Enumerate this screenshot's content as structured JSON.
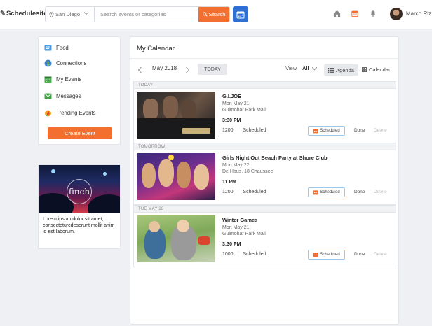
{
  "header": {
    "brand": "Schedulesite",
    "location": "San Diego",
    "search_placeholder": "Search events or categories",
    "search_label": "Search",
    "user_name": "Marco Riz"
  },
  "sidebar": {
    "items": [
      {
        "label": "Feed",
        "icon": "feed-icon"
      },
      {
        "label": "Connections",
        "icon": "globe-icon"
      },
      {
        "label": "My Events",
        "icon": "calendar-icon"
      },
      {
        "label": "Messages",
        "icon": "mail-icon"
      },
      {
        "label": "Trending Events",
        "icon": "flame-icon"
      }
    ],
    "create_label": "Create Event"
  },
  "ad": {
    "logo_text": "finch",
    "text": "Lorem ipsum dolor sit amet, consecteturcdeserunt mollit anim id est laborum."
  },
  "main": {
    "title": "My Calendar",
    "month": "May 2018",
    "today_label": "TODAY",
    "view_label": "View",
    "view_value": "All",
    "agenda_label": "Agenda",
    "calendar_label": "Calendar"
  },
  "groups": [
    {
      "label": "TODAY"
    },
    {
      "label": "TOMORROW"
    },
    {
      "label": "TUE MAY 26"
    }
  ],
  "events": [
    {
      "title": "G.I.JOE",
      "date": "Mon May 21",
      "venue": "Gulmohar Park Mall",
      "time": "3:30 PM",
      "count": "1200",
      "status": "Scheduled",
      "scheduled_label": "Scheduled",
      "done": "Done",
      "delete": "Delete"
    },
    {
      "title": "Girls Night Out Beach Party at Shore Club",
      "date": "Mon May 22",
      "venue": "De Haus, 18 Chaussée",
      "time": "11 PM",
      "count": "1200",
      "status": "Scheduled",
      "scheduled_label": "Scheduled",
      "done": "Done",
      "delete": "Delete"
    },
    {
      "title": "Winter Games",
      "date": "Mon May 21",
      "venue": "Gulmohar Park Mall",
      "time": "3:30 PM",
      "count": "1000",
      "status": "Scheduled",
      "scheduled_label": "Scheduled",
      "done": "Done",
      "delete": "Delete"
    }
  ],
  "colors": {
    "accent": "#f36f2f",
    "primary": "#2f6fd6"
  }
}
